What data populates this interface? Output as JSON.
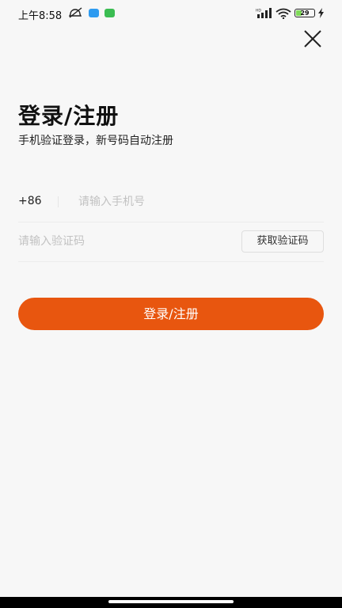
{
  "status_bar": {
    "time": "上午8:58",
    "battery_level": "29",
    "signal_label": "HD",
    "icons": [
      "mute-icon",
      "message-app-icon",
      "download-app-icon",
      "signal-icon",
      "wifi-icon",
      "battery-icon",
      "charging-icon"
    ]
  },
  "header": {
    "close_icon": "close-icon"
  },
  "title": "登录/注册",
  "subtitle": "手机验证登录，新号码自动注册",
  "phone": {
    "country_code": "+86",
    "placeholder": "请输入手机号"
  },
  "code": {
    "placeholder": "请输入验证码",
    "get_code_label": "获取验证码"
  },
  "submit_label": "登录/注册",
  "colors": {
    "accent": "#e8560f",
    "background": "#f7f7f7"
  }
}
